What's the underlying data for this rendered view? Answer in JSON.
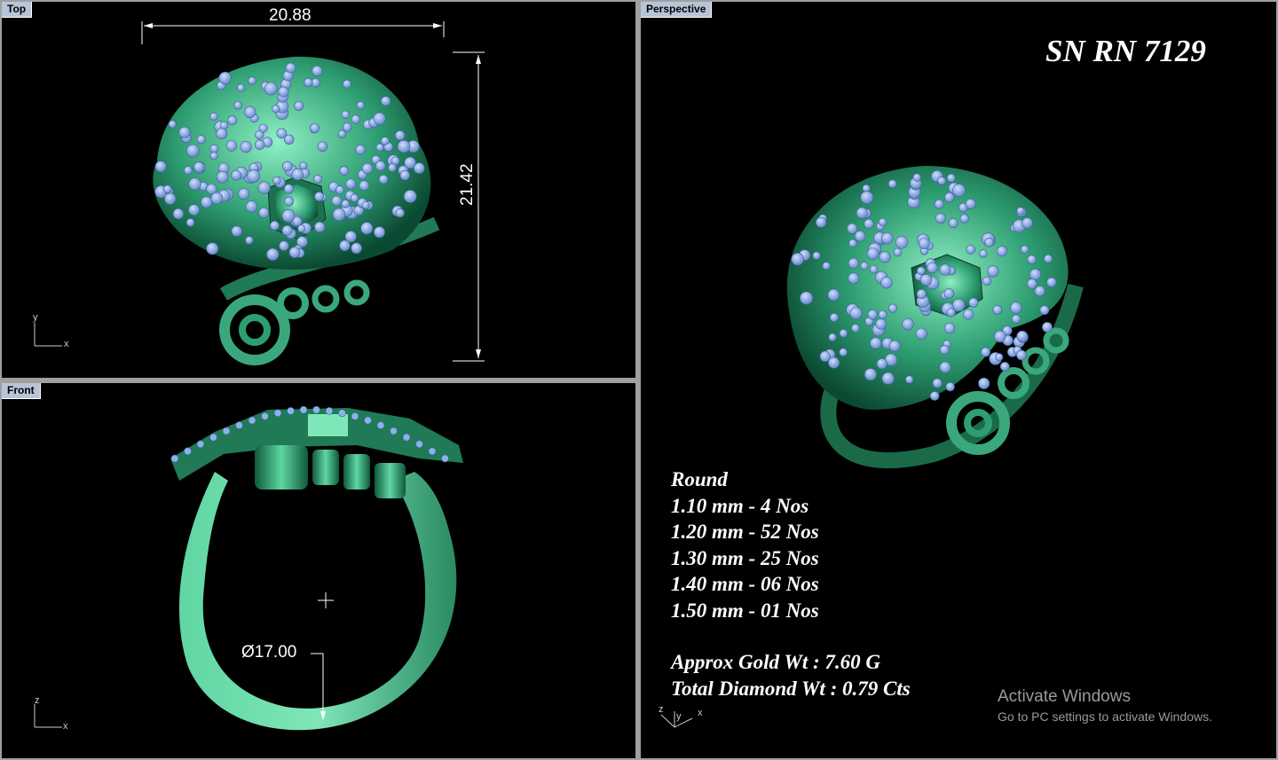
{
  "viewports": {
    "top": {
      "label": "Top",
      "dim_width": "20.88",
      "dim_height": "21.42",
      "axis_v": "y",
      "axis_h": "x"
    },
    "front": {
      "label": "Front",
      "dim_diameter": "Ø17.00",
      "axis_v": "z",
      "axis_h": "x"
    },
    "perspective": {
      "label": "Perspective",
      "axis_z": "z",
      "axis_y": "y",
      "axis_x": "x"
    }
  },
  "design": {
    "serial": "SN RN 7129",
    "shape": "Round",
    "stones": [
      "1.10 mm - 4 Nos",
      "1.20 mm - 52 Nos",
      "1.30 mm - 25 Nos",
      "1.40 mm - 06 Nos",
      "1.50 mm - 01 Nos"
    ],
    "gold_weight": "Approx Gold Wt : 7.60 G",
    "diamond_weight": "Total Diamond Wt : 0.79 Cts"
  },
  "watermark": {
    "title": "Activate Windows",
    "subtitle": "Go to PC settings to activate Windows."
  },
  "colors": {
    "metal": "#2e9e72",
    "metal_light": "#7fe6b8",
    "stone": "#8fb0e8",
    "background": "#000000"
  }
}
